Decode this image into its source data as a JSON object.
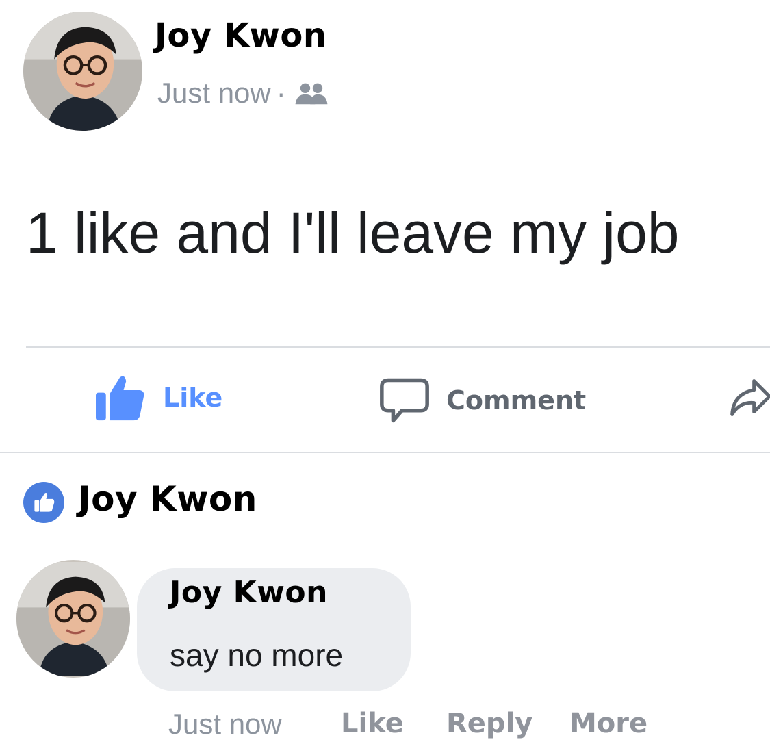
{
  "post": {
    "author": "Joy Kwon",
    "timestamp": "Just now",
    "separator": "·",
    "audience_icon": "friends-icon",
    "text": "1 like and I'll leave my job"
  },
  "actions": {
    "like_label": "Like",
    "comment_label": "Comment",
    "share_icon": "share-icon",
    "like_color": "#5890ff",
    "comment_color": "#606770"
  },
  "likes": {
    "icon": "like-badge-icon",
    "liker_name": "Joy Kwon",
    "badge_color": "#4a7ddd"
  },
  "comment": {
    "author": "Joy Kwon",
    "text": "say no more",
    "timestamp": "Just now",
    "like_label": "Like",
    "reply_label": "Reply",
    "more_label": "More",
    "bubble_color": "#ebedf0"
  }
}
